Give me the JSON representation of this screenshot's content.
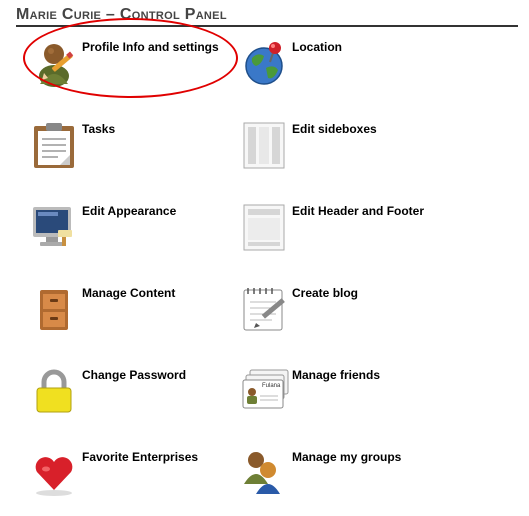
{
  "header": {
    "title": "Marie Curie – Control Panel"
  },
  "items": [
    {
      "label": "Profile Info and settings",
      "icon": "user-pencil-icon"
    },
    {
      "label": "Location",
      "icon": "globe-pin-icon"
    },
    {
      "label": "Tasks",
      "icon": "clipboard-icon"
    },
    {
      "label": "Edit sideboxes",
      "icon": "sideboxes-layout-icon"
    },
    {
      "label": "Edit Appearance",
      "icon": "monitor-brush-icon"
    },
    {
      "label": "Edit Header and Footer",
      "icon": "header-footer-layout-icon"
    },
    {
      "label": "Manage Content",
      "icon": "file-cabinet-icon"
    },
    {
      "label": "Create blog",
      "icon": "notepad-pencil-icon"
    },
    {
      "label": "Change Password",
      "icon": "padlock-icon"
    },
    {
      "label": "Manage friends",
      "icon": "contact-cards-icon"
    },
    {
      "label": "Favorite Enterprises",
      "icon": "heart-icon"
    },
    {
      "label": "Manage my groups",
      "icon": "group-users-icon"
    }
  ],
  "contact_cards": {
    "card_text": "Fulana"
  },
  "colors": {
    "highlight_ring": "#e00000",
    "title_text": "#444444"
  }
}
